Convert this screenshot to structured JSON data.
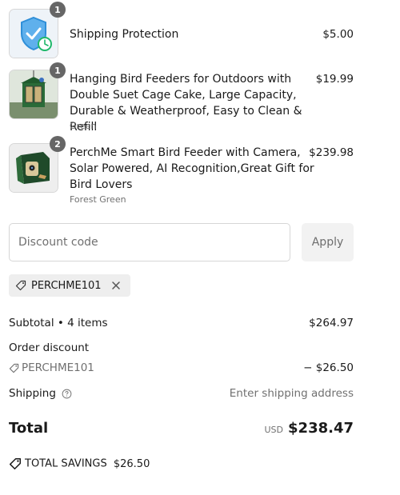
{
  "items": [
    {
      "title": "Shipping Protection",
      "variant": "",
      "price": "$5.00",
      "qty": "1",
      "icon": "shield-clock-icon"
    },
    {
      "title": "Hanging Bird Feeders for Outdoors with Double Suet Cage Cake, Large Capacity, Durable & Weatherproof, Easy to Clean & Refill",
      "variant": "Green",
      "price": "$19.99",
      "qty": "1",
      "icon": "bird-feeder-image"
    },
    {
      "title": "PerchMe Smart Bird Feeder with Camera, Solar Powered, AI Recognition,Great Gift for Bird Lovers",
      "variant": "Forest Green",
      "price": "$239.98",
      "qty": "2",
      "icon": "smart-feeder-image"
    }
  ],
  "discount": {
    "placeholder": "Discount code",
    "apply_label": "Apply",
    "applied_code": "PERCHME101"
  },
  "summary": {
    "subtotal_label": "Subtotal • 4 items",
    "subtotal_value": "$264.97",
    "order_discount_label": "Order discount",
    "order_discount_code": "PERCHME101",
    "order_discount_value": "− $26.50",
    "shipping_label": "Shipping",
    "shipping_value": "Enter shipping address",
    "total_label": "Total",
    "total_currency": "USD",
    "total_value": "$238.47",
    "savings_label": "TOTAL SAVINGS",
    "savings_value": "$26.50"
  },
  "colors": {
    "shield": "#2f8fd8",
    "clock": "#1fb86a",
    "feeder_green": "#1f5a2c"
  }
}
